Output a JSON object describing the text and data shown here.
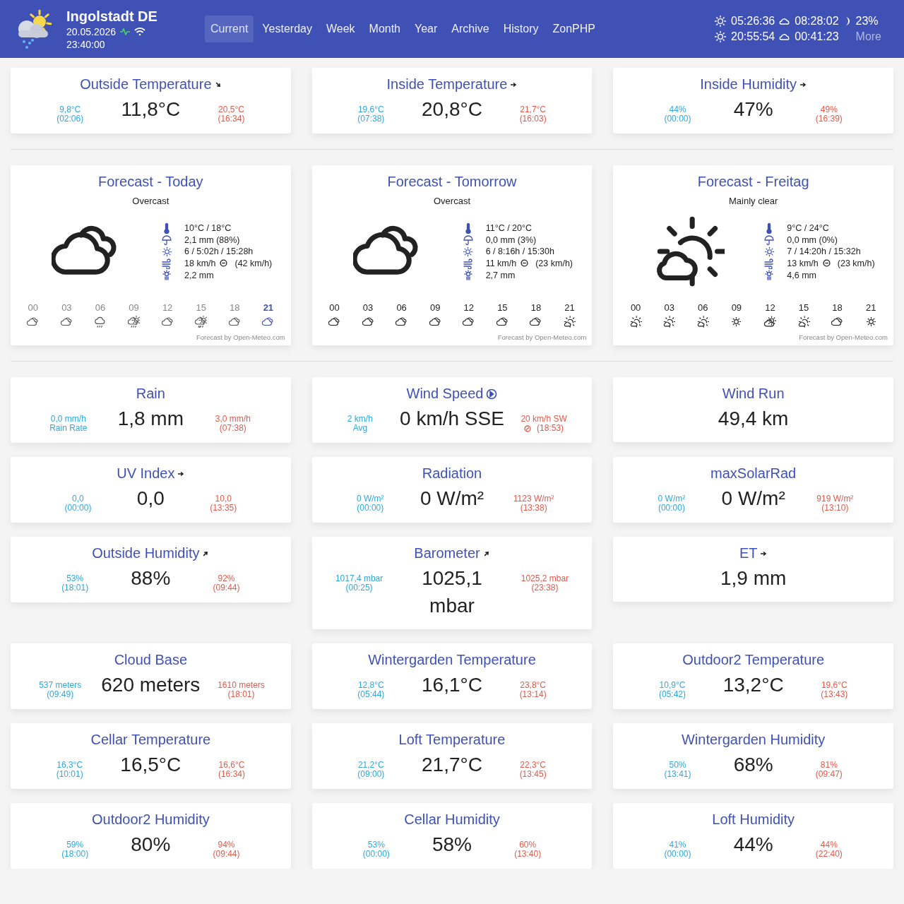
{
  "header": {
    "station": "Ingolstadt DE",
    "date": "20.05.2026",
    "time": "23:40:00",
    "nav": [
      {
        "label": "Current",
        "selected": true
      },
      {
        "label": "Yesterday",
        "selected": false
      },
      {
        "label": "Week",
        "selected": false
      },
      {
        "label": "Month",
        "selected": false
      },
      {
        "label": "Year",
        "selected": false
      },
      {
        "label": "Archive",
        "selected": false
      },
      {
        "label": "History",
        "selected": false
      },
      {
        "label": "ZonPHP",
        "selected": false
      }
    ],
    "almanac": [
      {
        "sun": "05:26:36",
        "moon": "08:28:02",
        "extra": "23%",
        "kind": "phase"
      },
      {
        "sun": "20:55:54",
        "moon": "00:41:23",
        "extra": "More",
        "kind": "link"
      }
    ]
  },
  "top_cards": [
    {
      "title": "Outside Temperature",
      "kind": "down",
      "value": "11,8°C",
      "low": [
        "9,8°C",
        "(02:06)"
      ],
      "high": [
        "20,5°C",
        "(16:34)"
      ]
    },
    {
      "title": "Inside Temperature",
      "kind": "steady",
      "value": "20,8°C",
      "low": [
        "19,6°C",
        "(07:38)"
      ],
      "high": [
        "21,7°C",
        "(16:03)"
      ]
    },
    {
      "title": "Inside Humidity",
      "kind": "steady",
      "value": "47%",
      "low": [
        "44%",
        "(00:00)"
      ],
      "high": [
        "49%",
        "(16:39)"
      ]
    }
  ],
  "forecasts": [
    {
      "title": "Forecast - Today",
      "condition": "Overcast",
      "kind": "cloudy",
      "temp": "10°C / 18°C",
      "precip": "2,1 mm (88%)",
      "sun": "6 / 5:02h / 15:28h",
      "wind": "18 km/h",
      "gust": "(42 km/h)",
      "et": "2,2 mm",
      "credit": "Forecast by Open-Meteo.com",
      "hours": [
        {
          "hour": "00",
          "kind": "cloudy",
          "past": true,
          "current": false
        },
        {
          "hour": "03",
          "kind": "cloudy",
          "past": true,
          "current": false
        },
        {
          "hour": "06",
          "kind": "drizzle",
          "past": true,
          "current": false
        },
        {
          "hour": "09",
          "kind": "sun-drizzle",
          "past": true,
          "current": false
        },
        {
          "hour": "12",
          "kind": "cloudy",
          "past": true,
          "current": false
        },
        {
          "hour": "15",
          "kind": "sun-rain",
          "past": true,
          "current": false
        },
        {
          "hour": "18",
          "kind": "cloudy",
          "past": true,
          "current": false
        },
        {
          "hour": "21",
          "kind": "cloudy",
          "past": false,
          "current": true
        }
      ]
    },
    {
      "title": "Forecast - Tomorrow",
      "condition": "Overcast",
      "kind": "cloudy",
      "temp": "11°C / 20°C",
      "precip": "0,0 mm (3%)",
      "sun": "6 / 8:16h / 15:30h",
      "wind": "11 km/h",
      "gust": "(23 km/h)",
      "et": "2,7 mm",
      "credit": "Forecast by Open-Meteo.com",
      "hours": [
        {
          "hour": "00",
          "kind": "cloudy",
          "past": false,
          "current": false
        },
        {
          "hour": "03",
          "kind": "cloudy",
          "past": false,
          "current": false
        },
        {
          "hour": "06",
          "kind": "cloudy",
          "past": false,
          "current": false
        },
        {
          "hour": "09",
          "kind": "cloudy",
          "past": false,
          "current": false
        },
        {
          "hour": "12",
          "kind": "cloudy",
          "past": false,
          "current": false
        },
        {
          "hour": "15",
          "kind": "cloudy",
          "past": false,
          "current": false
        },
        {
          "hour": "18",
          "kind": "cloudy",
          "past": false,
          "current": false
        },
        {
          "hour": "21",
          "kind": "partly",
          "past": false,
          "current": false
        }
      ]
    },
    {
      "title": "Forecast - Freitag",
      "condition": "Mainly clear",
      "kind": "partly",
      "temp": "9°C / 24°C",
      "precip": "0,0 mm (0%)",
      "sun": "7 / 14:20h / 15:32h",
      "wind": "13 km/h",
      "gust": "(23 km/h)",
      "et": "4,6 mm",
      "credit": "Forecast by Open-Meteo.com",
      "hours": [
        {
          "hour": "00",
          "kind": "partly",
          "past": false,
          "current": false
        },
        {
          "hour": "03",
          "kind": "partly",
          "past": false,
          "current": false
        },
        {
          "hour": "06",
          "kind": "partly",
          "past": false,
          "current": false
        },
        {
          "hour": "09",
          "kind": "sunny",
          "past": false,
          "current": false
        },
        {
          "hour": "12",
          "kind": "sun-cloud",
          "past": false,
          "current": false
        },
        {
          "hour": "15",
          "kind": "partly",
          "past": false,
          "current": false
        },
        {
          "hour": "18",
          "kind": "cloudy",
          "past": false,
          "current": false
        },
        {
          "hour": "21",
          "kind": "sunny",
          "past": false,
          "current": false
        }
      ]
    }
  ],
  "stat_cards": [
    {
      "title": "Rain",
      "kind": "plain",
      "value": "1,8 mm",
      "low": [
        "0,0 mm/h",
        "Rain Rate"
      ],
      "high": [
        "3,0 mm/h",
        "(07:38)"
      ]
    },
    {
      "title": "Wind Speed",
      "kind": "wind",
      "value": "0 km/h SSE",
      "low": [
        "2 km/h",
        "Avg"
      ],
      "high": [
        "20 km/h SW",
        "(18:53)"
      ]
    },
    {
      "title": "Wind Run",
      "kind": "plain",
      "value": "49,4 km"
    },
    {
      "title": "UV Index",
      "kind": "steady",
      "value": "0,0",
      "low": [
        "0,0",
        "(00:00)"
      ],
      "high": [
        "10,0",
        "(13:35)"
      ]
    },
    {
      "title": "Radiation",
      "kind": "plain",
      "value": "0 W/m²",
      "low": [
        "0 W/m²",
        "(00:00)"
      ],
      "high": [
        "1123 W/m²",
        "(13:38)"
      ]
    },
    {
      "title": "maxSolarRad",
      "kind": "plain",
      "value": "0 W/m²",
      "low": [
        "0 W/m²",
        "(00:00)"
      ],
      "high": [
        "919 W/m²",
        "(13:10)"
      ]
    },
    {
      "title": "Outside Humidity",
      "kind": "up",
      "value": "88%",
      "low": [
        "53%",
        "(18:01)"
      ],
      "high": [
        "92%",
        "(09:44)"
      ]
    },
    {
      "title": "Barometer",
      "kind": "up",
      "value": "1025,1 mbar",
      "low": [
        "1017,4 mbar",
        "(00:25)"
      ],
      "high": [
        "1025,2 mbar",
        "(23:38)"
      ]
    },
    {
      "title": "ET",
      "kind": "steady",
      "value": "1,9 mm"
    },
    {
      "title": "Cloud Base",
      "kind": "plain",
      "value": "620 meters",
      "low": [
        "537 meters",
        "(09:49)"
      ],
      "high": [
        "1610 meters",
        "(18:01)"
      ]
    },
    {
      "title": "Wintergarden Temperature",
      "kind": "plain",
      "value": "16,1°C",
      "low": [
        "12,8°C",
        "(05:44)"
      ],
      "high": [
        "23,8°C",
        "(13:14)"
      ]
    },
    {
      "title": "Outdoor2 Temperature",
      "kind": "plain",
      "value": "13,2°C",
      "low": [
        "10,9°C",
        "(05:42)"
      ],
      "high": [
        "19,6°C",
        "(13:43)"
      ]
    },
    {
      "title": "Cellar Temperature",
      "kind": "plain",
      "value": "16,5°C",
      "low": [
        "16,3°C",
        "(10:01)"
      ],
      "high": [
        "16,6°C",
        "(16:34)"
      ]
    },
    {
      "title": "Loft Temperature",
      "kind": "plain",
      "value": "21,7°C",
      "low": [
        "21,2°C",
        "(09:00)"
      ],
      "high": [
        "22,3°C",
        "(13:45)"
      ]
    },
    {
      "title": "Wintergarden Humidity",
      "kind": "plain",
      "value": "68%",
      "low": [
        "50%",
        "(13:41)"
      ],
      "high": [
        "81%",
        "(09:47)"
      ]
    },
    {
      "title": "Outdoor2 Humidity",
      "kind": "plain",
      "value": "80%",
      "low": [
        "59%",
        "(18:00)"
      ],
      "high": [
        "94%",
        "(09:44)"
      ]
    },
    {
      "title": "Cellar Humidity",
      "kind": "plain",
      "value": "58%",
      "low": [
        "53%",
        "(00:00)"
      ],
      "high": [
        "60%",
        "(13:40)"
      ]
    },
    {
      "title": "Loft Humidity",
      "kind": "plain",
      "value": "44%",
      "low": [
        "41%",
        "(00:00)"
      ],
      "high": [
        "44%",
        "(22:40)"
      ]
    }
  ]
}
